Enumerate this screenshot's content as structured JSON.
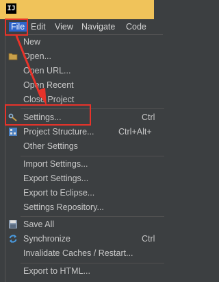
{
  "app_icon_text": "IJ",
  "menubar": {
    "items": [
      {
        "label": "File"
      },
      {
        "label": "Edit"
      },
      {
        "label": "View"
      },
      {
        "label": "Navigate"
      },
      {
        "label": "Code"
      }
    ]
  },
  "file_menu": {
    "items": [
      {
        "label": "New",
        "shortcut": ""
      },
      {
        "label": "Open...",
        "shortcut": ""
      },
      {
        "label": "Open URL...",
        "shortcut": ""
      },
      {
        "label": "Open Recent",
        "shortcut": ""
      },
      {
        "label": "Close Project",
        "shortcut": ""
      },
      {
        "label": "Settings...",
        "shortcut": "Ctrl"
      },
      {
        "label": "Project Structure...",
        "shortcut": "Ctrl+Alt+"
      },
      {
        "label": "Other Settings",
        "shortcut": ""
      },
      {
        "label": "Import Settings...",
        "shortcut": ""
      },
      {
        "label": "Export Settings...",
        "shortcut": ""
      },
      {
        "label": "Export to Eclipse...",
        "shortcut": ""
      },
      {
        "label": "Settings Repository...",
        "shortcut": ""
      },
      {
        "label": "Save All",
        "shortcut": ""
      },
      {
        "label": "Synchronize",
        "shortcut": "Ctrl"
      },
      {
        "label": "Invalidate Caches / Restart...",
        "shortcut": ""
      },
      {
        "label": "Export to HTML...",
        "shortcut": ""
      }
    ]
  },
  "colors": {
    "titlebar": "#f0c35a",
    "menu_bg": "#3c3f41",
    "highlight": "#e8332a"
  }
}
